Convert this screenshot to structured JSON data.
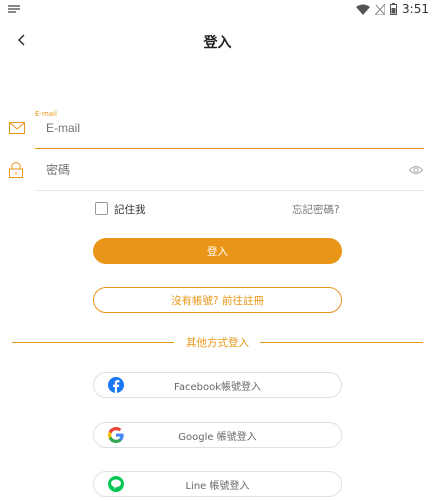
{
  "status_bar": {
    "time": "3:51"
  },
  "header": {
    "title": "登入"
  },
  "email_field": {
    "floating_label": "E-mail",
    "placeholder": "E-mail"
  },
  "password_field": {
    "placeholder": "密碼"
  },
  "remember": {
    "label": "記住我"
  },
  "forgot_password": {
    "label": "忘記密碼?"
  },
  "login_button": {
    "label": "登入"
  },
  "register_button": {
    "label": "沒有帳號? 前往註冊"
  },
  "divider": {
    "label": "其他方式登入"
  },
  "social_logins": [
    {
      "label": "Facebook帳號登入",
      "icon": "facebook-icon"
    },
    {
      "label": "Google 帳號登入",
      "icon": "google-icon"
    },
    {
      "label": "Line 帳號登入",
      "icon": "line-icon"
    }
  ],
  "colors": {
    "accent": "#e99618",
    "facebook": "#1877f2",
    "line": "#06c755"
  }
}
